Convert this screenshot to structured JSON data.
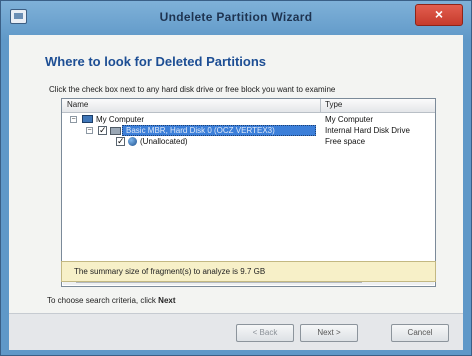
{
  "window": {
    "title": "Undelete Partition Wizard"
  },
  "page": {
    "heading": "Where to look for Deleted Partitions",
    "instruction": "Click the check box next to any hard disk drive or free block you want to examine"
  },
  "tree": {
    "columns": {
      "name": "Name",
      "type": "Type"
    },
    "rows": [
      {
        "name": "My Computer",
        "type": "My Computer",
        "expander": "−"
      },
      {
        "name": "Basic MBR, Hard Disk 0 (OCZ VERTEX3)",
        "type": "Internal Hard Disk Drive",
        "expander": "−",
        "checked": "✓"
      },
      {
        "name": "(Unallocated)",
        "type": "Free space",
        "checked": "✓"
      }
    ],
    "scroll_left": "◂",
    "scroll_right": "▸"
  },
  "summary": {
    "text": "The summary size of fragment(s) to analyze is 9.7 GB"
  },
  "hint": {
    "prefix": "To choose search criteria, click",
    "action": "Next"
  },
  "buttons": {
    "back": "< Back",
    "next": "Next >",
    "cancel": "Cancel"
  },
  "icons": {
    "close": "×"
  },
  "colors": {
    "accent": "#1d4e94",
    "selection": "#3c7fd9",
    "summary_bg": "#f7f0c8"
  }
}
